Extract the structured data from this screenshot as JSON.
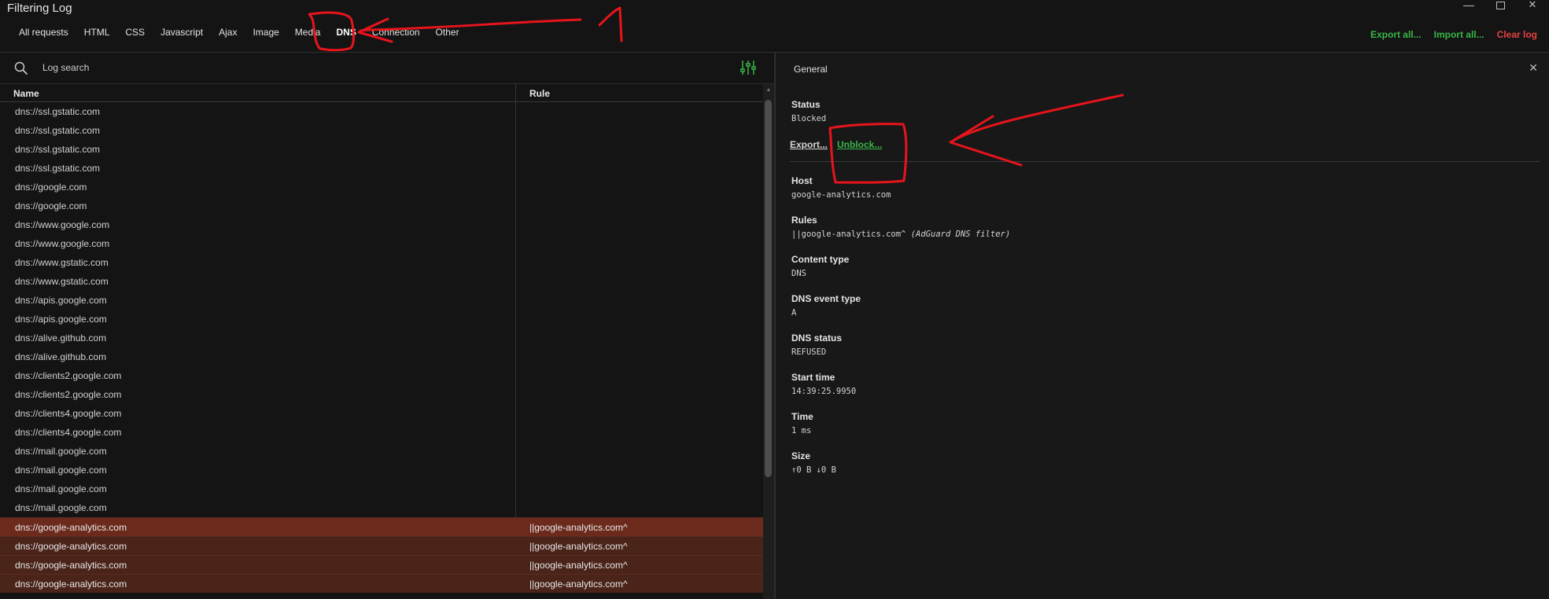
{
  "app": {
    "title": "Filtering Log"
  },
  "tabs": [
    {
      "label": "All requests"
    },
    {
      "label": "HTML"
    },
    {
      "label": "CSS"
    },
    {
      "label": "Javascript"
    },
    {
      "label": "Ajax"
    },
    {
      "label": "Image"
    },
    {
      "label": "Media"
    },
    {
      "label": "DNS"
    },
    {
      "label": "Connection"
    },
    {
      "label": "Other"
    }
  ],
  "header_actions": {
    "export_all": "Export all...",
    "import_all": "Import all...",
    "clear_log": "Clear log"
  },
  "search": {
    "placeholder": "Log search"
  },
  "table": {
    "columns": {
      "name": "Name",
      "rule": "Rule"
    },
    "rows": [
      {
        "name": "dns://ssl.gstatic.com",
        "rule": ""
      },
      {
        "name": "dns://ssl.gstatic.com",
        "rule": ""
      },
      {
        "name": "dns://ssl.gstatic.com",
        "rule": ""
      },
      {
        "name": "dns://ssl.gstatic.com",
        "rule": ""
      },
      {
        "name": "dns://google.com",
        "rule": ""
      },
      {
        "name": "dns://google.com",
        "rule": ""
      },
      {
        "name": "dns://www.google.com",
        "rule": ""
      },
      {
        "name": "dns://www.google.com",
        "rule": ""
      },
      {
        "name": "dns://www.gstatic.com",
        "rule": ""
      },
      {
        "name": "dns://www.gstatic.com",
        "rule": ""
      },
      {
        "name": "dns://apis.google.com",
        "rule": ""
      },
      {
        "name": "dns://apis.google.com",
        "rule": ""
      },
      {
        "name": "dns://alive.github.com",
        "rule": ""
      },
      {
        "name": "dns://alive.github.com",
        "rule": ""
      },
      {
        "name": "dns://clients2.google.com",
        "rule": ""
      },
      {
        "name": "dns://clients2.google.com",
        "rule": ""
      },
      {
        "name": "dns://clients4.google.com",
        "rule": ""
      },
      {
        "name": "dns://clients4.google.com",
        "rule": ""
      },
      {
        "name": "dns://mail.google.com",
        "rule": ""
      },
      {
        "name": "dns://mail.google.com",
        "rule": ""
      },
      {
        "name": "dns://mail.google.com",
        "rule": ""
      },
      {
        "name": "dns://mail.google.com",
        "rule": ""
      },
      {
        "name": "dns://google-analytics.com",
        "rule": "||google-analytics.com^",
        "blocked": true
      },
      {
        "name": "dns://google-analytics.com",
        "rule": "||google-analytics.com^",
        "blocked": true
      },
      {
        "name": "dns://google-analytics.com",
        "rule": "||google-analytics.com^",
        "blocked": true
      },
      {
        "name": "dns://google-analytics.com",
        "rule": "||google-analytics.com^",
        "blocked": true
      }
    ]
  },
  "details": {
    "title": "General",
    "status_label": "Status",
    "status_value": "Blocked",
    "export_link": "Export...",
    "unblock_link": "Unblock...",
    "host_label": "Host",
    "host_value": "google-analytics.com",
    "rules_label": "Rules",
    "rules_value": "||google-analytics.com^",
    "rules_source": "(AdGuard DNS filter)",
    "content_type_label": "Content type",
    "content_type_value": "DNS",
    "dns_event_label": "DNS event type",
    "dns_event_value": "A",
    "dns_status_label": "DNS status",
    "dns_status_value": "REFUSED",
    "start_time_label": "Start time",
    "start_time_value": "14:39:25.9950",
    "time_label": "Time",
    "time_value": "1 ms",
    "size_label": "Size",
    "size_value": "↑0 B ↓0 B"
  },
  "colors": {
    "accent_green": "#38b548",
    "danger_red": "#e84141",
    "blocked_row": "#4a2319",
    "annotation": "#e8141c"
  }
}
